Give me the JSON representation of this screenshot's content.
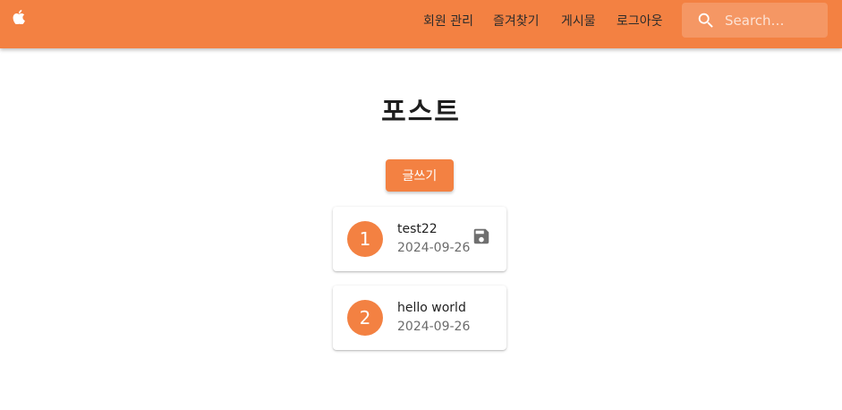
{
  "header": {
    "logo_icon": "apple-icon",
    "nav": [
      {
        "label": "회원 관리"
      },
      {
        "label": "즐겨찾기"
      },
      {
        "label": "게시물"
      },
      {
        "label": "로그아웃"
      }
    ],
    "search": {
      "placeholder": "Search…",
      "value": "",
      "icon": "search-icon"
    }
  },
  "main": {
    "title": "포스트",
    "write_label": "글쓰기",
    "posts": [
      {
        "number": "1",
        "title": "test22",
        "date": "2024-09-26",
        "action_icon": "save-icon"
      },
      {
        "number": "2",
        "title": "hello world",
        "date": "2024-09-26"
      }
    ]
  },
  "colors": {
    "accent": "#f38142",
    "nav_text": "#2b2b2b",
    "card_bg": "#ffffff"
  }
}
